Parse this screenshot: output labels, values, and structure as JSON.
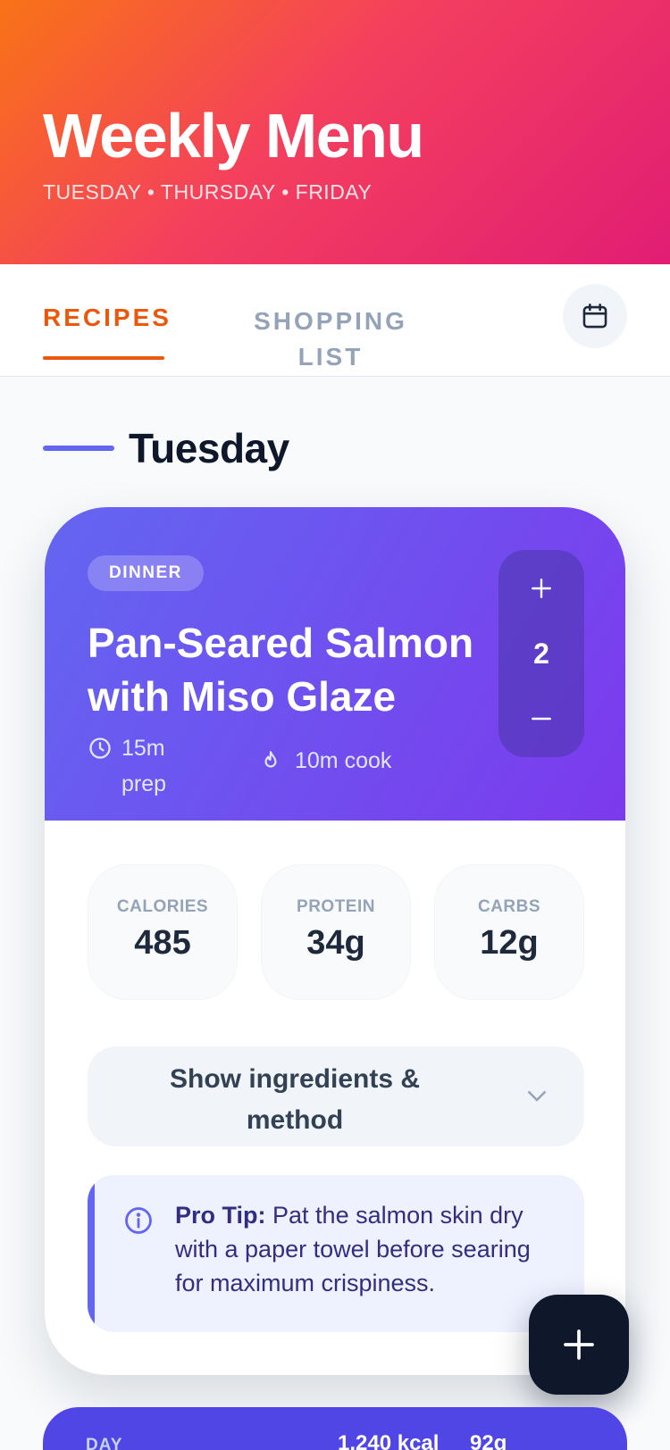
{
  "header": {
    "title": "Weekly Menu",
    "subtitle": "TUESDAY • THURSDAY • FRIDAY"
  },
  "tabs": {
    "recipes": "RECIPES",
    "shopping": "SHOPPING LIST",
    "active": "RECIPES"
  },
  "day": {
    "title": "Tuesday"
  },
  "recipe": {
    "badge": "DINNER",
    "title": "Pan-Seared Salmon with Miso Glaze",
    "prep": "15m prep",
    "cook": "10m cook",
    "servings": "2",
    "stats": [
      {
        "label": "CALORIES",
        "value": "485"
      },
      {
        "label": "PROTEIN",
        "value": "34g"
      },
      {
        "label": "CARBS",
        "value": "12g"
      }
    ],
    "toggle_label": "Show ingredients & method",
    "tip": {
      "label": "Pro Tip:",
      "text": "Pat the salmon skin dry with a paper towel before searing for maximum crispiness."
    }
  },
  "summary": {
    "label": "DAY",
    "kcal": "1,240 kcal",
    "grams": "92g"
  },
  "colors": {
    "accent": "#ea580c",
    "indigo": "#6366f1",
    "violet": "#7c3aed",
    "header_start": "#f97316",
    "header_end": "#e11d74"
  },
  "icons": {
    "calendar": "calendar-icon",
    "clock": "clock-icon",
    "flame": "flame-icon",
    "plus": "plus-icon",
    "minus": "minus-icon",
    "chevron": "chevron-down-icon",
    "info": "info-icon"
  }
}
